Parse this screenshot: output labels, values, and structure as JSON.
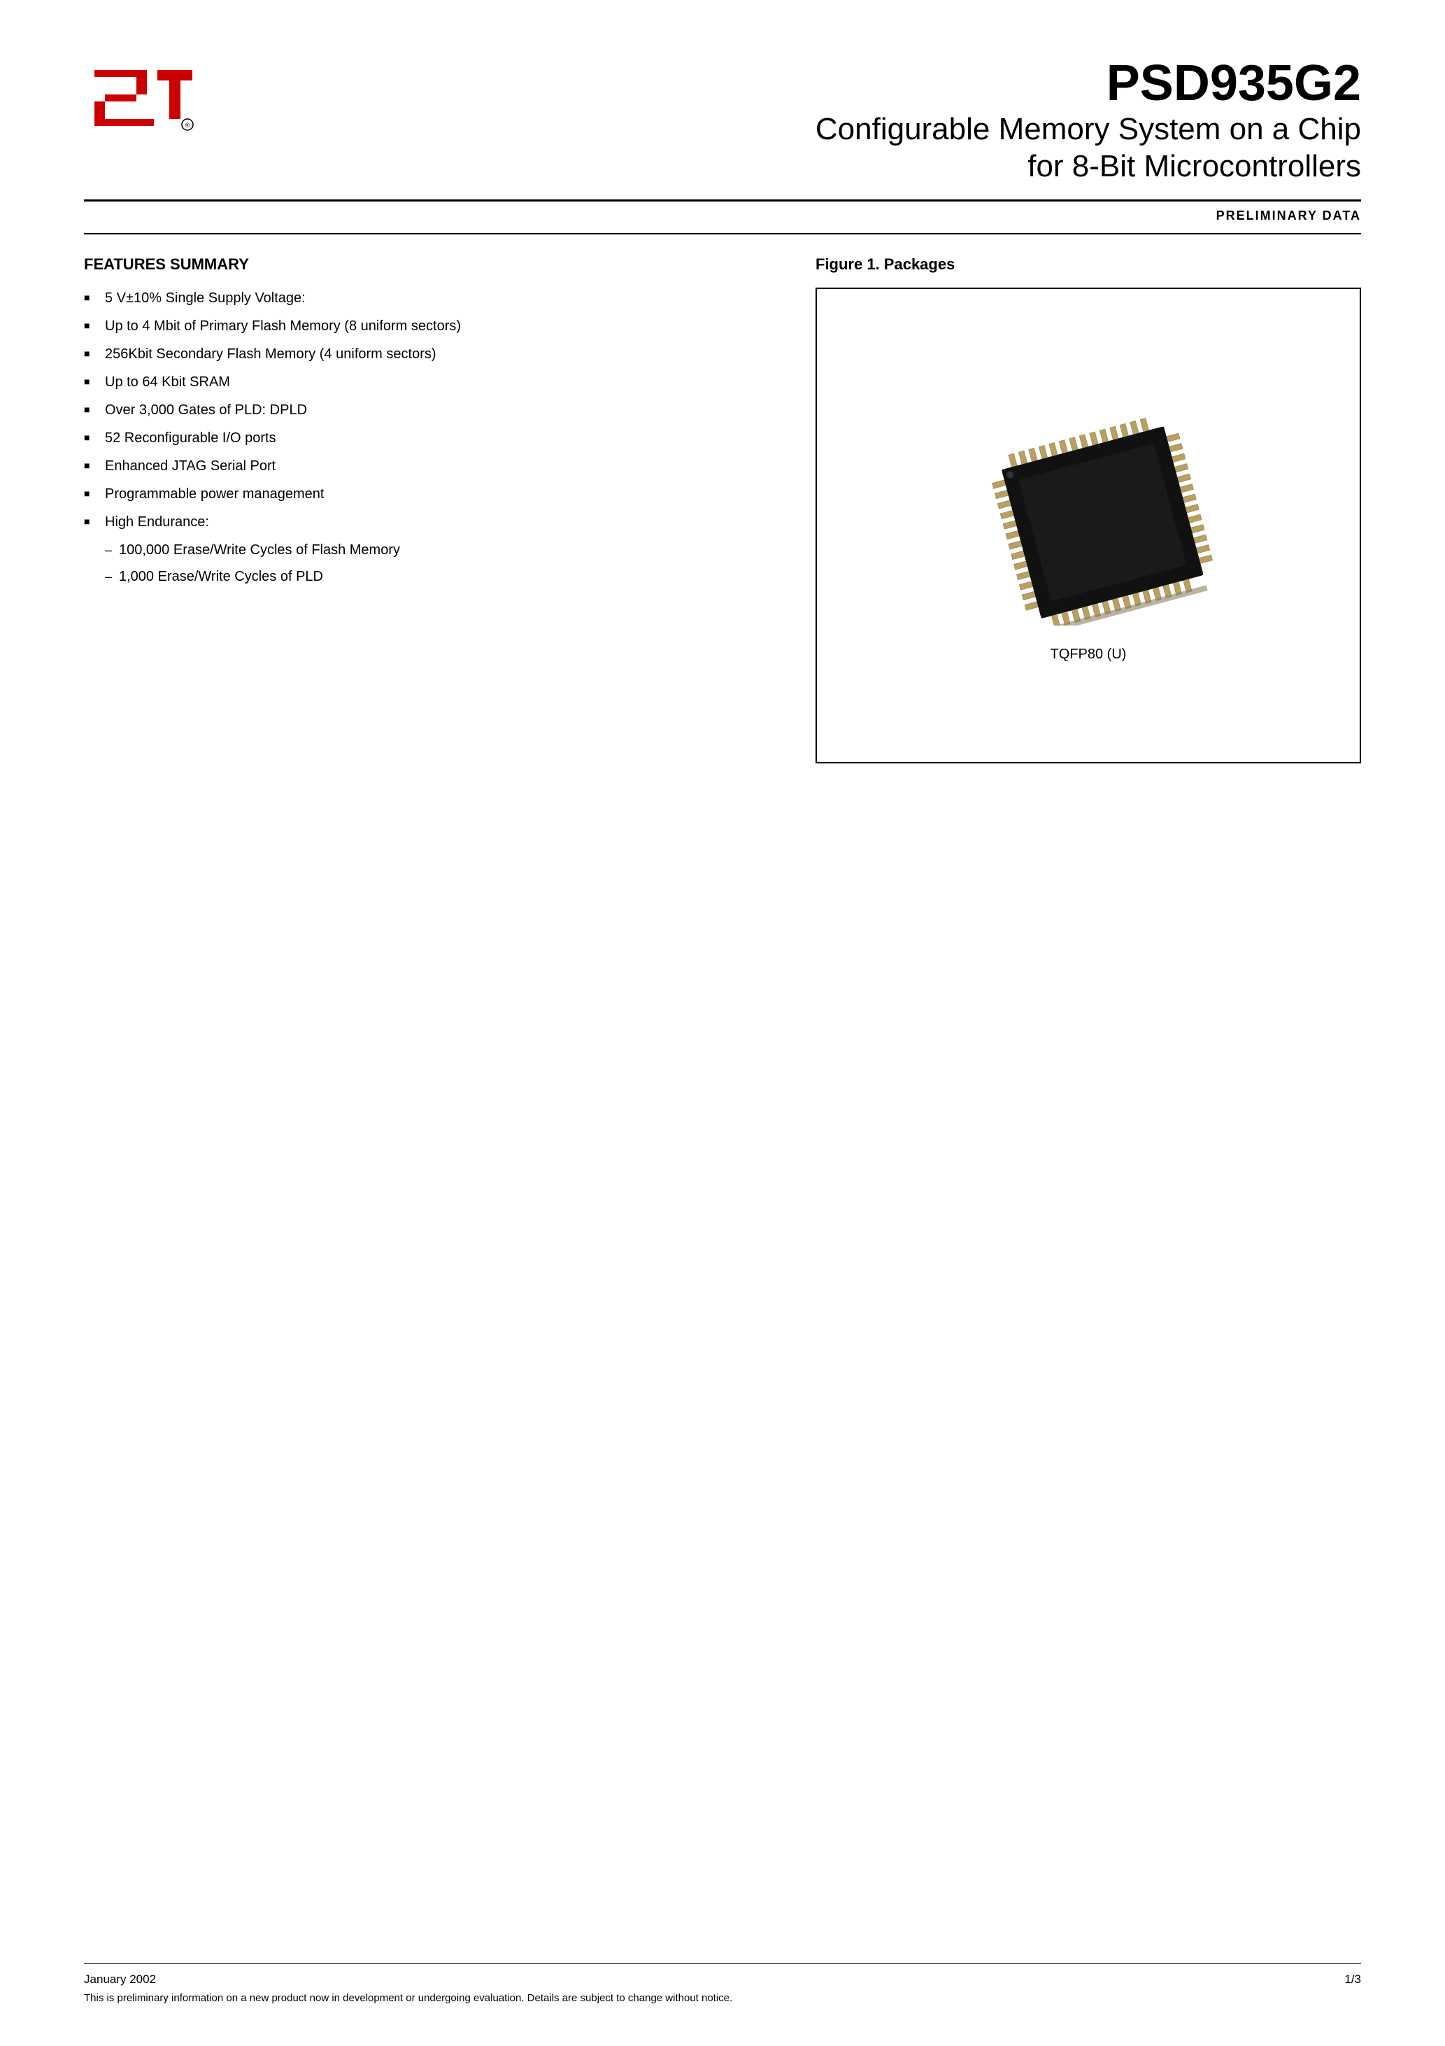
{
  "header": {
    "product_number": "PSD935G2",
    "subtitle_line1": "Configurable Memory System on a Chip",
    "subtitle_line2": "for 8-Bit Microcontrollers",
    "preliminary_label": "PRELIMINARY DATA"
  },
  "features": {
    "title": "FEATURES SUMMARY",
    "items": [
      {
        "text": "5 V±10% Single Supply Voltage:",
        "type": "bullet"
      },
      {
        "text": "Up to 4 Mbit of Primary Flash Memory (8 uniform sectors)",
        "type": "bullet"
      },
      {
        "text": "256Kbit Secondary Flash Memory (4 uniform sectors)",
        "type": "bullet"
      },
      {
        "text": "Up to 64 Kbit SRAM",
        "type": "bullet"
      },
      {
        "text": "Over 3,000 Gates of PLD: DPLD",
        "type": "bullet"
      },
      {
        "text": "52 Reconfigurable I/O ports",
        "type": "bullet"
      },
      {
        "text": "Enhanced JTAG Serial Port",
        "type": "bullet"
      },
      {
        "text": "Programmable power management",
        "type": "bullet"
      },
      {
        "text": "High Endurance:",
        "type": "bullet"
      },
      {
        "text": "100,000 Erase/Write Cycles of Flash Memory",
        "type": "sub"
      },
      {
        "text": "1,000 Erase/Write Cycles of PLD",
        "type": "sub"
      }
    ]
  },
  "figure": {
    "title": "Figure 1. Packages",
    "chip_label": "TQFP80 (U)"
  },
  "footer": {
    "date": "January 2002",
    "page": "1/3",
    "notice": "This is preliminary information on a new product now in development or undergoing evaluation. Details are subject to change without notice."
  }
}
